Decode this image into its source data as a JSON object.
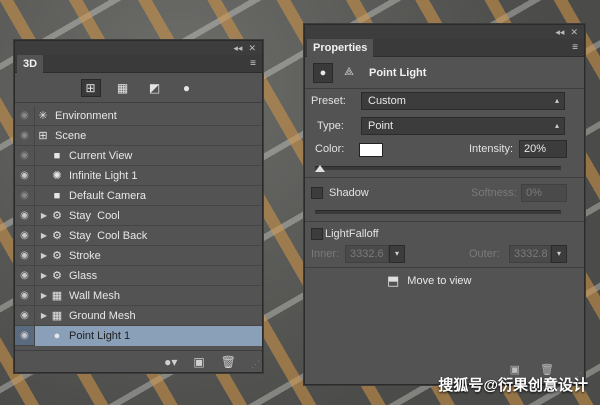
{
  "panel3d": {
    "tab": "3D",
    "filters": [
      {
        "icon": "scene-filter-icon",
        "active": true
      },
      {
        "icon": "mesh-filter-icon",
        "active": false
      },
      {
        "icon": "material-filter-icon",
        "active": false
      },
      {
        "icon": "light-filter-icon",
        "active": false
      }
    ],
    "layers": [
      {
        "label": "Environment",
        "icon": "environment-icon",
        "expandable": false,
        "indent": 0,
        "eye_dim": true
      },
      {
        "label": "Scene",
        "icon": "scene-icon",
        "expandable": false,
        "indent": 0,
        "eye_dim": true
      },
      {
        "label": "Current View",
        "icon": "camera-icon",
        "expandable": false,
        "indent": 1,
        "eye_dim": true
      },
      {
        "label": "Infinite Light 1",
        "icon": "infinite-light-icon",
        "expandable": false,
        "indent": 1,
        "eye_dim": false
      },
      {
        "label": "Default Camera",
        "icon": "camera-icon",
        "expandable": false,
        "indent": 1,
        "eye_dim": true
      },
      {
        "label": "Stay  Cool",
        "icon": "mesh-icon",
        "expandable": true,
        "indent": 1,
        "eye_dim": false
      },
      {
        "label": "Stay  Cool Back",
        "icon": "mesh-icon",
        "expandable": true,
        "indent": 1,
        "eye_dim": false
      },
      {
        "label": "Stroke",
        "icon": "mesh-icon",
        "expandable": true,
        "indent": 1,
        "eye_dim": false
      },
      {
        "label": "Glass",
        "icon": "mesh-icon",
        "expandable": true,
        "indent": 1,
        "eye_dim": false
      },
      {
        "label": "Wall Mesh",
        "icon": "wall-mesh-icon",
        "expandable": true,
        "indent": 1,
        "eye_dim": false
      },
      {
        "label": "Ground Mesh",
        "icon": "wall-mesh-icon",
        "expandable": true,
        "indent": 1,
        "eye_dim": false
      },
      {
        "label": "Point Light 1",
        "icon": "point-light-icon",
        "expandable": false,
        "indent": 1,
        "eye_dim": false,
        "selected": true
      }
    ],
    "footer": [
      "add-light-icon",
      "render-icon",
      "trash-icon"
    ]
  },
  "properties": {
    "tab": "Properties",
    "title": "Point Light",
    "preset_label": "Preset:",
    "preset_value": "Custom",
    "type_label": "Type:",
    "type_value": "Point",
    "color_label": "Color:",
    "color_value": "#ffffff",
    "intensity_label": "Intensity:",
    "intensity_value": "20%",
    "intensity_fraction": 0.02,
    "shadow_label": "Shadow",
    "softness_label": "Softness:",
    "softness_value": "0%",
    "falloff_label": "LightFalloff",
    "inner_label": "Inner:",
    "inner_value": "3332.6",
    "outer_label": "Outer:",
    "outer_value": "3332.8",
    "move_to_view": "Move to view"
  },
  "watermark": "搜狐号@衍果创意设计"
}
